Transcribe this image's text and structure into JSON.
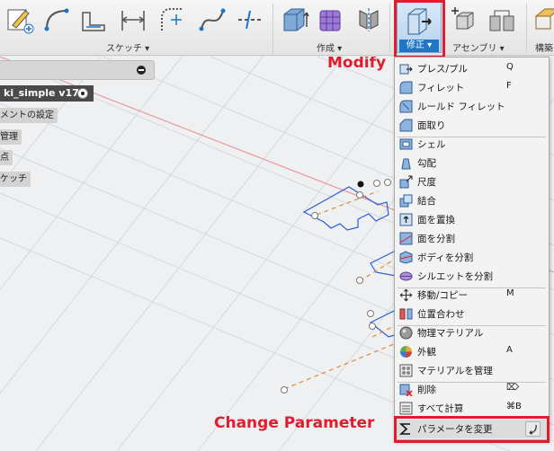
{
  "toolbar": {
    "groups": {
      "sketch": "スケッチ ▾",
      "create": "作成 ▾",
      "modify": "修正 ▾",
      "assemble": "アセンブリ ▾",
      "construct": "構築"
    }
  },
  "browser": {
    "document_name": "ki_simple v17",
    "rows": [
      "メントの設定",
      "管理",
      "点",
      "ケッチ"
    ]
  },
  "callouts": {
    "modify": "Modify",
    "change_parameter": "Change Parameter"
  },
  "menu": {
    "items": [
      {
        "label": "プレス/プル",
        "shortcut": "Q",
        "icon": "press-pull-icon"
      },
      {
        "label": "フィレット",
        "shortcut": "F",
        "icon": "fillet-icon"
      },
      {
        "label": "ルールド フィレット",
        "shortcut": "",
        "icon": "rule-fillet-icon"
      },
      {
        "label": "面取り",
        "shortcut": "",
        "icon": "chamfer-icon"
      },
      {
        "label": "シェル",
        "shortcut": "",
        "icon": "shell-icon"
      },
      {
        "label": "勾配",
        "shortcut": "",
        "icon": "draft-icon"
      },
      {
        "label": "尺度",
        "shortcut": "",
        "icon": "scale-icon"
      },
      {
        "label": "結合",
        "shortcut": "",
        "icon": "combine-icon"
      },
      {
        "label": "面を置換",
        "shortcut": "",
        "icon": "replace-face-icon"
      },
      {
        "label": "面を分割",
        "shortcut": "",
        "icon": "split-face-icon"
      },
      {
        "label": "ボディを分割",
        "shortcut": "",
        "icon": "split-body-icon"
      },
      {
        "label": "シルエットを分割",
        "shortcut": "",
        "icon": "silhouette-split-icon"
      },
      {
        "label": "移動/コピー",
        "shortcut": "M",
        "icon": "move-icon"
      },
      {
        "label": "位置合わせ",
        "shortcut": "",
        "icon": "align-icon"
      },
      {
        "label": "物理マテリアル",
        "shortcut": "",
        "icon": "physical-material-icon"
      },
      {
        "label": "外観",
        "shortcut": "A",
        "icon": "appearance-icon"
      },
      {
        "label": "マテリアルを管理",
        "shortcut": "",
        "icon": "manage-materials-icon"
      },
      {
        "label": "削除",
        "shortcut": "⌦",
        "icon": "delete-icon"
      },
      {
        "label": "すべて計算",
        "shortcut": "⌘B",
        "icon": "compute-all-icon"
      },
      {
        "label": "パラメータを変更",
        "shortcut": "",
        "icon": "sigma-icon"
      }
    ]
  },
  "colors": {
    "accent": "#1f76c6",
    "highlight": "#e21c2d"
  }
}
